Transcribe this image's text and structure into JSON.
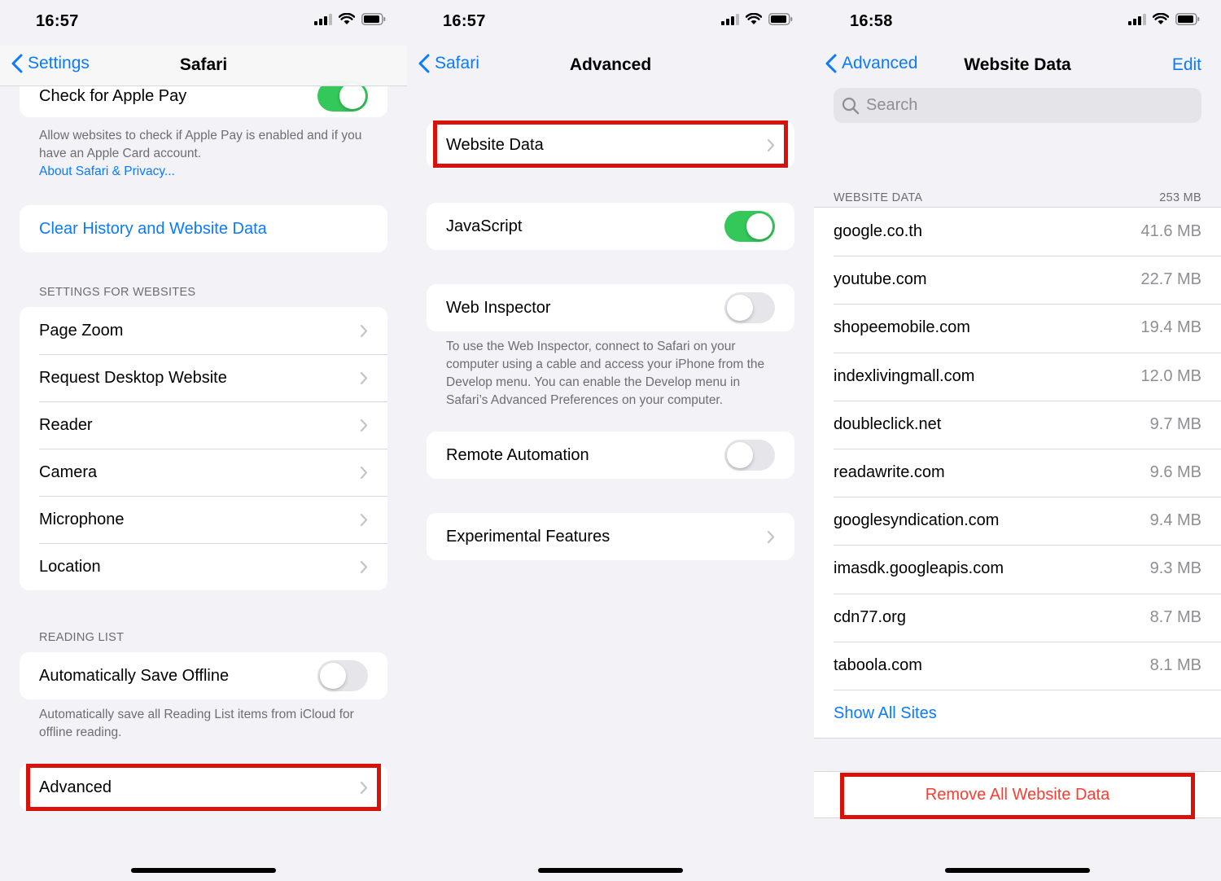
{
  "colors": {
    "accent": "#0a7aff",
    "toggle_on": "#34c759",
    "destructive": "#ff3b30",
    "highlight": "#d8120a"
  },
  "panel1": {
    "time": "16:57",
    "back_label": "Settings",
    "title": "Safari",
    "apple_pay": {
      "label": "Check for Apple Pay",
      "on": true
    },
    "apple_pay_note": "Allow websites to check if Apple Pay is enabled and if you have an Apple Card account.",
    "privacy_link": "About Safari & Privacy...",
    "clear_history": "Clear History and Website Data",
    "websites_header": "SETTINGS FOR WEBSITES",
    "websites_items": [
      "Page Zoom",
      "Request Desktop Website",
      "Reader",
      "Camera",
      "Microphone",
      "Location"
    ],
    "reading_header": "READING LIST",
    "save_offline": {
      "label": "Automatically Save Offline",
      "on": false
    },
    "reading_note": "Automatically save all Reading List items from iCloud for offline reading.",
    "advanced": "Advanced"
  },
  "panel2": {
    "time": "16:57",
    "back_label": "Safari",
    "title": "Advanced",
    "website_data": "Website Data",
    "javascript": {
      "label": "JavaScript",
      "on": true
    },
    "web_inspector": {
      "label": "Web Inspector",
      "on": false
    },
    "inspector_note": "To use the Web Inspector, connect to Safari on your computer using a cable and access your iPhone from the Develop menu. You can enable the Develop menu in Safari’s Advanced Preferences on your computer.",
    "remote_automation": {
      "label": "Remote Automation",
      "on": false
    },
    "experimental": "Experimental Features"
  },
  "panel3": {
    "time": "16:58",
    "back_label": "Advanced",
    "title": "Website Data",
    "edit": "Edit",
    "search_placeholder": "Search",
    "section_header": "WEBSITE DATA",
    "total_size": "253 MB",
    "sites": [
      {
        "domain": "google.co.th",
        "size": "41.6 MB"
      },
      {
        "domain": "youtube.com",
        "size": "22.7 MB"
      },
      {
        "domain": "shopeemobile.com",
        "size": "19.4 MB"
      },
      {
        "domain": "indexlivingmall.com",
        "size": "12.0 MB"
      },
      {
        "domain": "doubleclick.net",
        "size": "9.7 MB"
      },
      {
        "domain": "readawrite.com",
        "size": "9.6 MB"
      },
      {
        "domain": "googlesyndication.com",
        "size": "9.4 MB"
      },
      {
        "domain": "imasdk.googleapis.com",
        "size": "9.3 MB"
      },
      {
        "domain": "cdn77.org",
        "size": "8.7 MB"
      },
      {
        "domain": "taboola.com",
        "size": "8.1 MB"
      }
    ],
    "show_all": "Show All Sites",
    "remove_all": "Remove All Website Data"
  }
}
